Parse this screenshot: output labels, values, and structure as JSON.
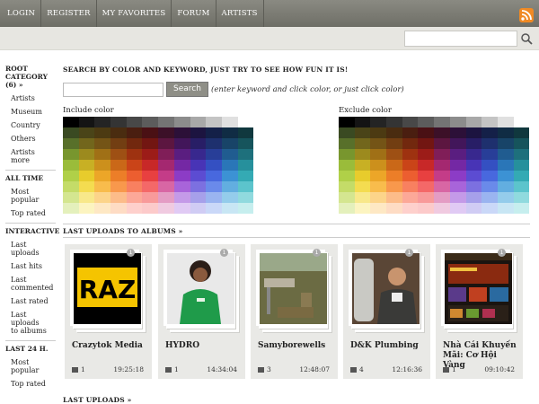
{
  "nav": {
    "items": [
      "LOGIN",
      "REGISTER",
      "MY FAVORITES",
      "FORUM",
      "ARTISTS"
    ]
  },
  "sidebar": {
    "root": "ROOT CATEGORY (6) »",
    "categories": [
      "Artists",
      "Museum",
      "Country",
      "Others",
      "Artists more"
    ],
    "all_time_title": "ALL TIME",
    "all_time": [
      "Most popular",
      "Top rated"
    ],
    "interactive_title": "INTERACTIVE",
    "interactive": [
      "Last uploads",
      "Last hits",
      "Last commented",
      "Last rated",
      "Last uploads to albums"
    ],
    "last24_title": "LAST 24 H.",
    "last24": [
      "Most popular",
      "Top rated"
    ]
  },
  "search": {
    "heading": "SEARCH BY COLOR AND KEYWORD, JUST TRY TO SEE HOW FUN IT IS!",
    "button": "Search",
    "hint": "(enter keyword and click color, or just click color)",
    "include_label": "Include color",
    "exclude_label": "Exclude color"
  },
  "albums_heading": "LAST UPLOADS TO ALBUMS »",
  "cards": [
    {
      "title": "Crazytok Media",
      "comments": "1",
      "time": "19:25:18",
      "badge": "1"
    },
    {
      "title": "HYDRO",
      "comments": "1",
      "time": "14:34:04",
      "badge": "1"
    },
    {
      "title": "Samyborewells",
      "comments": "3",
      "time": "12:48:07",
      "badge": "1"
    },
    {
      "title": "D&K Plumbing",
      "comments": "4",
      "time": "12:16:36",
      "badge": "1"
    },
    {
      "title": "Nhà Cái Khuyến Mãi: Cơ Hội Vàng",
      "comments": "1",
      "time": "09:10:42",
      "badge": "1"
    }
  ],
  "last_uploads_heading": "LAST UPLOADS »",
  "colors": {
    "palette_rows": [
      [
        "#000000",
        "#141414",
        "#242424",
        "#343434",
        "#484848",
        "#5c5c5c",
        "#747474",
        "#8c8c8c",
        "#a8a8a8",
        "#c4c4c4",
        "#e0e0e0",
        "#ffffff"
      ],
      [
        "#3a4a22",
        "#4a4418",
        "#4c3a12",
        "#4a2c10",
        "#4a1e10",
        "#4a1014",
        "#3c1028",
        "#2c1038",
        "#1c1440",
        "#142048",
        "#102c44",
        "#10383e"
      ],
      [
        "#58702a",
        "#72661c",
        "#745416",
        "#723e12",
        "#72280e",
        "#721612",
        "#5c1640",
        "#42165a",
        "#281e66",
        "#1e306e",
        "#184468",
        "#16545c"
      ],
      [
        "#78962e",
        "#9c8a1e",
        "#a07016",
        "#9e5014",
        "#9e3210",
        "#9c1c18",
        "#801e58",
        "#5a1e80",
        "#38288e",
        "#283e98",
        "#205c90",
        "#1e707c"
      ],
      [
        "#9abc3a",
        "#c8b024",
        "#cc901c",
        "#ca6818",
        "#ca4418",
        "#c82828",
        "#a42870",
        "#7428a4",
        "#4834b6",
        "#3450c2",
        "#2a76b8",
        "#26909c"
      ],
      [
        "#b0d048",
        "#e8cc2c",
        "#eca628",
        "#ec7e28",
        "#ec5e30",
        "#e84040",
        "#c43c88",
        "#8c3cc6",
        "#5c4cd2",
        "#4868de",
        "#3c92d4",
        "#34aab4"
      ],
      [
        "#c4dc68",
        "#f4dc50",
        "#f8bc4c",
        "#f8984c",
        "#f88060",
        "#f46868",
        "#d866a4",
        "#a864da",
        "#7c70e0",
        "#6a8aea",
        "#62aee0",
        "#5cc4cc"
      ],
      [
        "#d4e690",
        "#f8e88a",
        "#fcd48a",
        "#fcbc8a",
        "#fca898",
        "#f89a9a",
        "#e49cc4",
        "#c49ae8",
        "#a6a0ea",
        "#9ab4f0",
        "#94cceb",
        "#90dade"
      ],
      [
        "#e4f0bc",
        "#fcf4c0",
        "#fee8c4",
        "#fedcc4",
        "#fed0cc",
        "#fccaca",
        "#f0cae0",
        "#e0caf4",
        "#d0ccf4",
        "#cad8f8",
        "#c8e6f4",
        "#c6eeee"
      ]
    ]
  }
}
